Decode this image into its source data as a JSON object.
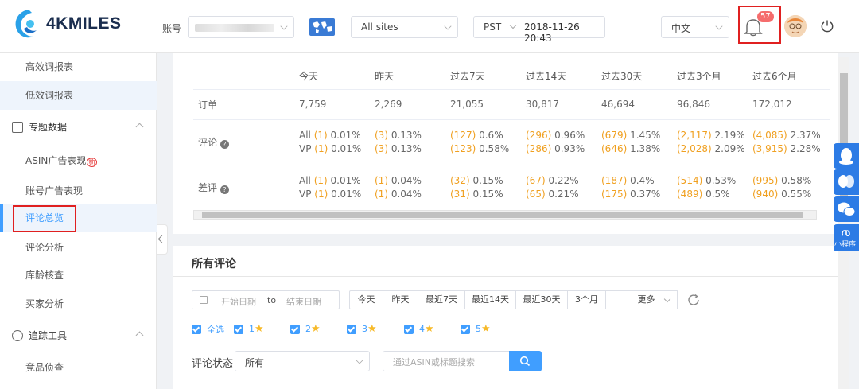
{
  "header": {
    "brand": "4KMILES",
    "account_label": "账号",
    "sites_value": "All sites",
    "timezone": "PST",
    "datetime": "2018-11-26 20:43",
    "language": "中文",
    "notification_count": "57"
  },
  "sidebar": {
    "items": [
      {
        "label": "高效词报表"
      },
      {
        "label": "低效词报表"
      },
      {
        "label": "专题数据"
      },
      {
        "label": "ASIN广告表现"
      },
      {
        "label": "账号广告表现"
      },
      {
        "label": "评论总览"
      },
      {
        "label": "评论分析"
      },
      {
        "label": "库龄核查"
      },
      {
        "label": "买家分析"
      },
      {
        "label": "追踪工具"
      },
      {
        "label": "竞品侦查"
      }
    ],
    "new_mark": "新"
  },
  "summary": {
    "columns": [
      "今天",
      "昨天",
      "过去7天",
      "过去14天",
      "过去30天",
      "过去3个月",
      "过去6个月"
    ],
    "orders_label": "订单",
    "orders": [
      "7,759",
      "2,269",
      "21,055",
      "30,817",
      "46,694",
      "96,846",
      "172,012"
    ],
    "reviews_label": "评论",
    "bad_label": "差评",
    "all_prefix": "All",
    "vp_prefix": "VP",
    "reviews_all": [
      [
        "(1)",
        "0.01%"
      ],
      [
        "(3)",
        "0.13%"
      ],
      [
        "(127)",
        "0.6%"
      ],
      [
        "(296)",
        "0.96%"
      ],
      [
        "(679)",
        "1.45%"
      ],
      [
        "(2,117)",
        "2.19%"
      ],
      [
        "(4,085)",
        "2.37%"
      ]
    ],
    "reviews_vp": [
      [
        "(1)",
        "0.01%"
      ],
      [
        "(3)",
        "0.13%"
      ],
      [
        "(123)",
        "0.58%"
      ],
      [
        "(286)",
        "0.93%"
      ],
      [
        "(646)",
        "1.38%"
      ],
      [
        "(2,028)",
        "2.09%"
      ],
      [
        "(3,915)",
        "2.28%"
      ]
    ],
    "bad_all": [
      [
        "(1)",
        "0.01%"
      ],
      [
        "(1)",
        "0.04%"
      ],
      [
        "(32)",
        "0.15%"
      ],
      [
        "(67)",
        "0.22%"
      ],
      [
        "(187)",
        "0.4%"
      ],
      [
        "(514)",
        "0.53%"
      ],
      [
        "(995)",
        "0.58%"
      ]
    ],
    "bad_vp": [
      [
        "(1)",
        "0.01%"
      ],
      [
        "(1)",
        "0.04%"
      ],
      [
        "(31)",
        "0.15%"
      ],
      [
        "(65)",
        "0.21%"
      ],
      [
        "(175)",
        "0.37%"
      ],
      [
        "(489)",
        "0.5%"
      ],
      [
        "(940)",
        "0.55%"
      ]
    ]
  },
  "all_reviews": {
    "title": "所有评论",
    "start_placeholder": "开始日期",
    "to": "to",
    "end_placeholder": "结束日期",
    "ranges": [
      "今天",
      "昨天",
      "最近7天",
      "最近14天",
      "最近30天",
      "3个月"
    ],
    "more": "更多",
    "select_all": "全选",
    "stars": [
      "1",
      "2",
      "3",
      "4",
      "5"
    ],
    "status_label": "评论状态",
    "status_value": "所有",
    "search_placeholder": "通过ASIN或标题搜索"
  },
  "floating": {
    "mini_program": "小程序"
  }
}
